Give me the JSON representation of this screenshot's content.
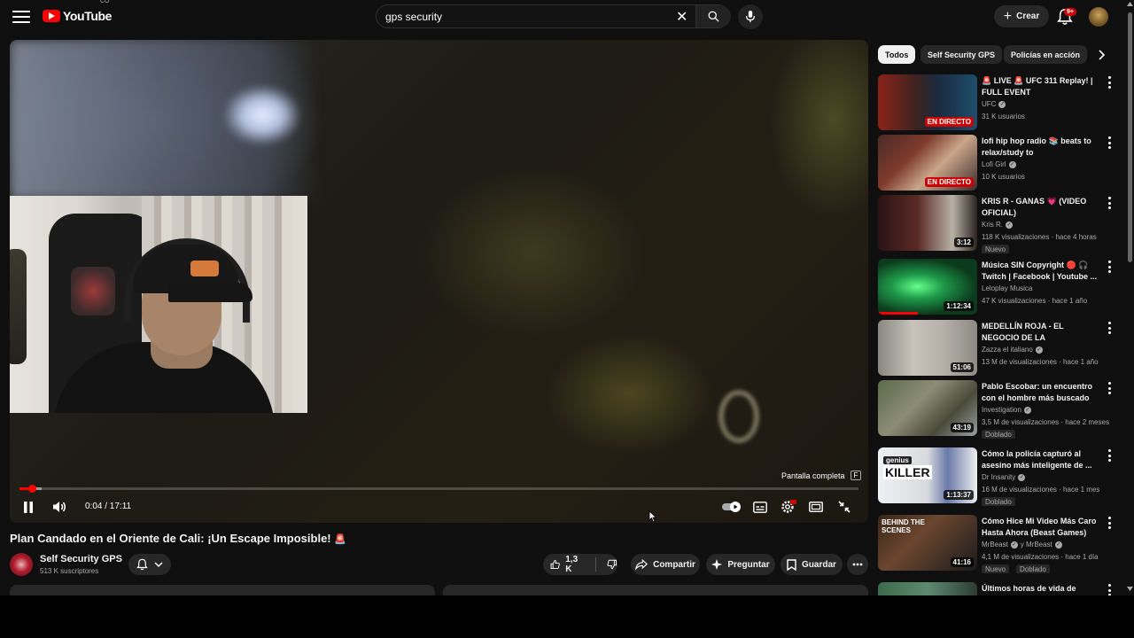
{
  "header": {
    "logo_text": "YouTube",
    "logo_country": "CO",
    "search_value": "gps security",
    "create_label": "Crear",
    "notifications_badge": "9+"
  },
  "player": {
    "fullscreen_hint": "Pantalla completa",
    "fullscreen_key": "F",
    "time_display": "0:04 / 17:11",
    "progress_fraction": 0.004,
    "buffer_fraction": 0.016
  },
  "video": {
    "title": "Plan Candado en el Oriente de Cali: ¡Un Escape Imposible!",
    "title_emoji": "🚨",
    "channel_name": "Self Security GPS",
    "subscribers": "513 K suscriptores",
    "likes": "1,3 K",
    "share_label": "Compartir",
    "ask_label": "Preguntar",
    "save_label": "Guardar"
  },
  "sidebar": {
    "chips": [
      "Todos",
      "Self Security GPS",
      "Policías en acción"
    ],
    "items": [
      {
        "title": "🚨 LIVE 🚨 UFC 311 Replay! | FULL EVENT",
        "channel": "UFC",
        "verified": true,
        "meta": "31 K usuarios",
        "live": "EN DIRECTO",
        "thumb": "ufc"
      },
      {
        "title": "lofi hip hop radio 📚 beats to relax/study to",
        "channel": "Lofi Girl",
        "verified": true,
        "meta": "10 K usuarios",
        "live": "EN DIRECTO",
        "thumb": "lofi"
      },
      {
        "title": "KRIS R - GANAS 💗 (VIDEO OFICIAL)",
        "channel": "Kris R.",
        "verified": true,
        "meta": "118 K visualizaciones · hace 4 horas",
        "duration": "3:12",
        "badge": "Nuevo",
        "thumb": "kris"
      },
      {
        "title": "Música SIN Copyright 🔴 🎧 Twitch | Facebook | Youtube ...",
        "channel": "Leloplay Musica",
        "verified": false,
        "meta": "47 K visualizaciones · hace 1 año",
        "duration": "1:12:34",
        "thumb": "musica",
        "watched": 0.4
      },
      {
        "title": "MEDELLÍN ROJA - EL NEGOCIO DE LA PROSTITUCIÓN co",
        "channel": "Zazza el italiano",
        "verified": true,
        "meta": "13 M de visualizaciones · hace 1 año",
        "duration": "51:06",
        "thumb": "medellin"
      },
      {
        "title": "Pablo Escobar: un encuentro con el hombre más buscado d...",
        "channel": "Investigation",
        "verified": true,
        "meta": "3,5 M de visualizaciones · hace 2 meses",
        "duration": "43:19",
        "badge": "Doblado",
        "thumb": "pablo"
      },
      {
        "title": "Cómo la policía capturó al asesino más inteligente de ...",
        "channel": "Dr Insanity",
        "verified": true,
        "meta": "16 M de visualizaciones · hace 1 mes",
        "duration": "1:13:37",
        "badge": "Doblado",
        "thumb": "killer",
        "thumb_text": "KILLER",
        "thumb_small": "genius"
      },
      {
        "title": "Cómo Hice Mi Video Más Caro Hasta Ahora (Beast Games)",
        "channel": "MrBeast",
        "channel_extra": "y MrBeast",
        "verified": true,
        "meta": "4,1 M de visualizaciones · hace 1 día",
        "duration": "41:16",
        "badge": "Nuevo",
        "badge2": "Doblado",
        "thumb": "beast",
        "thumb_text": "BEHIND THE SCENES"
      },
      {
        "title": "Últimos horas de vida de",
        "channel": "",
        "verified": false,
        "meta": "",
        "thumb": "last"
      }
    ]
  }
}
